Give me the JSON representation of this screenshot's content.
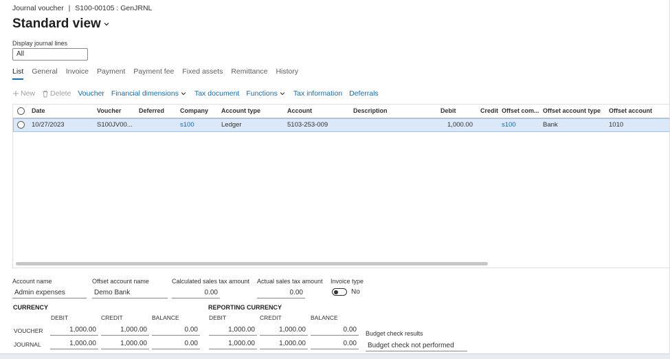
{
  "breadcrumb": {
    "section": "Journal voucher",
    "separator": "|",
    "record": "S100-00105 : GenJRNL"
  },
  "view": {
    "title": "Standard view"
  },
  "filter": {
    "label": "Display journal lines",
    "value": "All"
  },
  "tabs": [
    {
      "label": "List",
      "active": true
    },
    {
      "label": "General"
    },
    {
      "label": "Invoice"
    },
    {
      "label": "Payment"
    },
    {
      "label": "Payment fee"
    },
    {
      "label": "Fixed assets"
    },
    {
      "label": "Remittance"
    },
    {
      "label": "History"
    }
  ],
  "toolbar": {
    "new_label": "New",
    "delete_label": "Delete",
    "voucher_label": "Voucher",
    "financial_dimensions_label": "Financial dimensions",
    "tax_document_label": "Tax document",
    "functions_label": "Functions",
    "tax_information_label": "Tax information",
    "deferrals_label": "Deferrals"
  },
  "grid": {
    "columns": [
      "Date",
      "Voucher",
      "Deferred",
      "Company",
      "Account type",
      "Account",
      "Description",
      "Debit",
      "Credit",
      "Offset com...",
      "Offset account type",
      "Offset account"
    ],
    "rows": [
      {
        "date": "10/27/2023",
        "voucher": "S100JV00...",
        "deferred": "",
        "company": "s100",
        "account_type": "Ledger",
        "account": "5103-253-009",
        "description": "",
        "debit": "1,000.00",
        "credit": "",
        "offset_company": "s100",
        "offset_account_type": "Bank",
        "offset_account": "1010"
      }
    ]
  },
  "details": {
    "account_name_label": "Account name",
    "account_name_value": "Admin expenses",
    "offset_account_name_label": "Offset account name",
    "offset_account_name_value": "Demo Bank",
    "calc_tax_label": "Calculated sales tax amount",
    "calc_tax_value": "0.00",
    "actual_tax_label": "Actual sales tax amount",
    "actual_tax_value": "0.00",
    "invoice_type_label": "Invoice type",
    "invoice_type_value": "No"
  },
  "totals": {
    "currency_label": "CURRENCY",
    "reporting_currency_label": "REPORTING CURRENCY",
    "debit_label": "DEBIT",
    "credit_label": "CREDIT",
    "balance_label": "BALANCE",
    "voucher_label": "VOUCHER",
    "journal_label": "JOURNAL",
    "voucher": {
      "debit": "1,000.00",
      "credit": "1,000.00",
      "balance": "0.00",
      "rep_debit": "1,000.00",
      "rep_credit": "1,000.00",
      "rep_balance": "0.00"
    },
    "journal": {
      "debit": "1,000.00",
      "credit": "1,000.00",
      "balance": "0.00",
      "rep_debit": "1,000.00",
      "rep_credit": "1,000.00",
      "rep_balance": "0.00"
    }
  },
  "budget": {
    "label": "Budget check results",
    "value": "Budget check not performed"
  },
  "colors": {
    "accent": "#0f6cbd",
    "selected_row": "#dbe8f7"
  }
}
